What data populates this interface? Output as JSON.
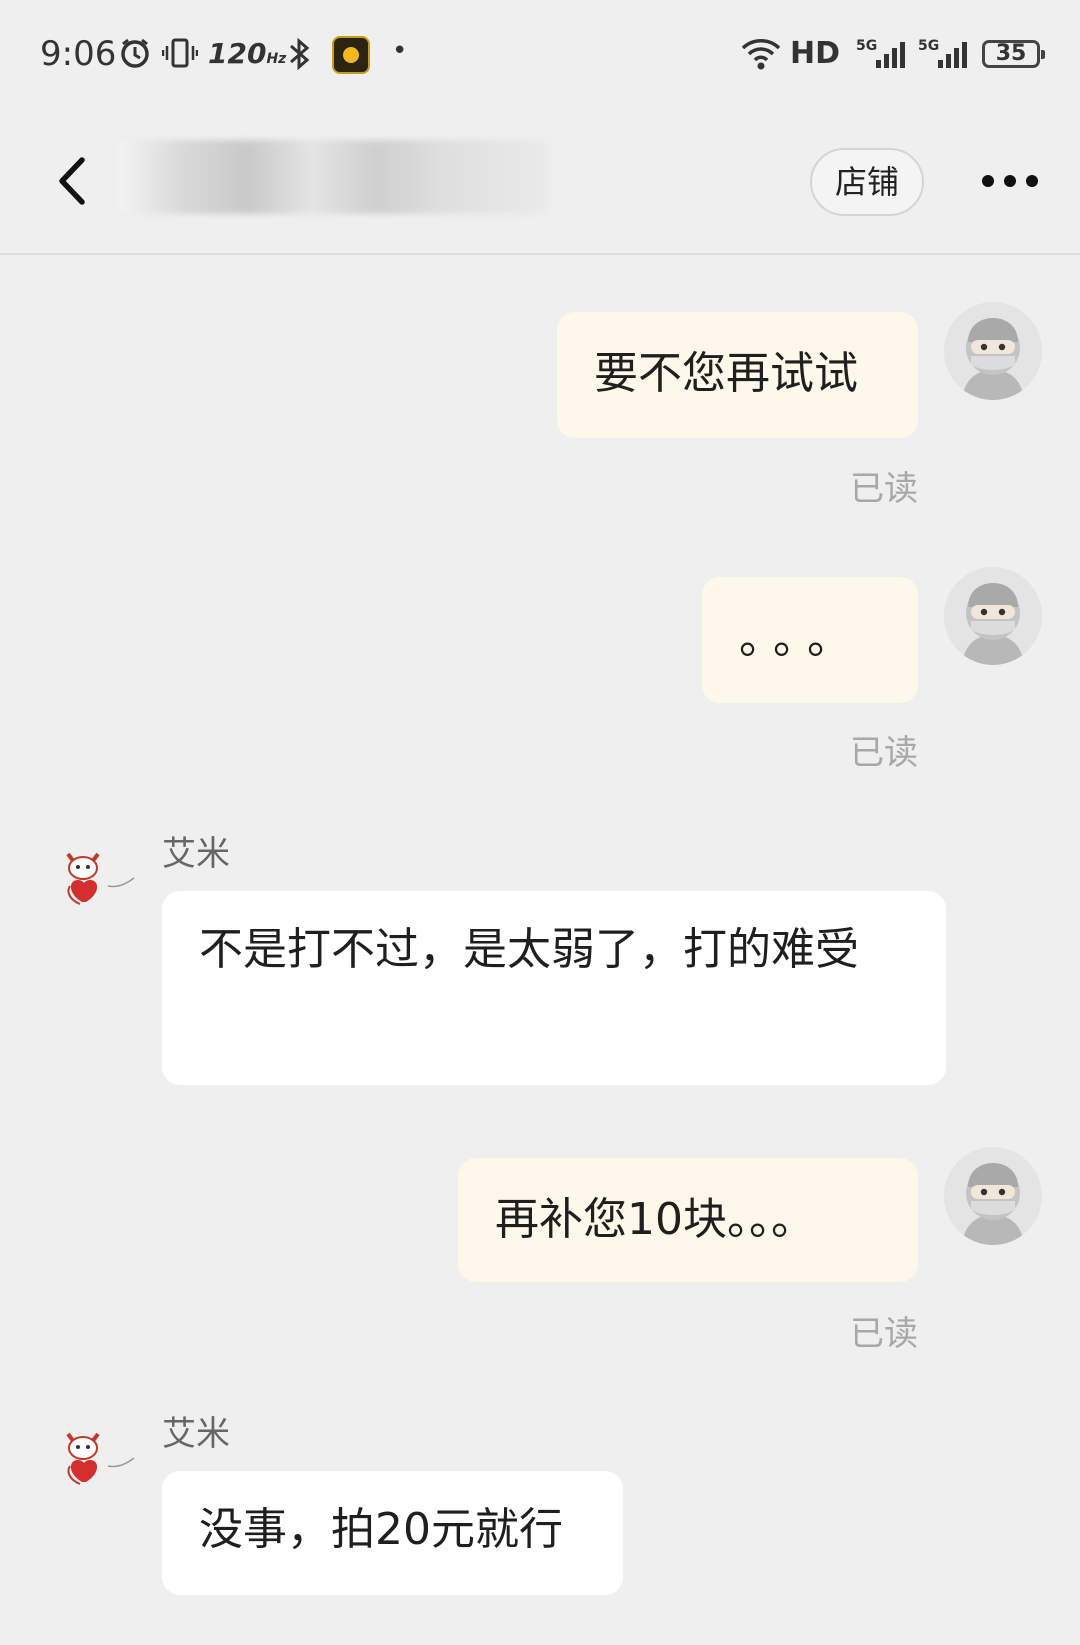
{
  "status_bar": {
    "time": "9:06",
    "refresh_rate": "120",
    "refresh_unit": "Hz",
    "network_label": "HD",
    "sim1": "5G",
    "sim2": "5G",
    "battery": "35",
    "icons": [
      "alarm-icon",
      "vibrate-icon",
      "bluetooth-icon",
      "app-notification-icon",
      "wifi-icon",
      "signal-icon",
      "battery-icon"
    ]
  },
  "header": {
    "shop_label": "店铺",
    "icons": [
      "back-arrow-icon",
      "more-dots-icon"
    ]
  },
  "messages": [
    {
      "from": "me",
      "text": "要不您再试试",
      "status": "已读"
    },
    {
      "from": "me",
      "text": "。。。",
      "status": "已读"
    },
    {
      "from": "them",
      "sender": "艾米",
      "text": "不是打不过，是太弱了，打的难受"
    },
    {
      "from": "me",
      "text": "再补您10块。。。",
      "status": "已读"
    },
    {
      "from": "them",
      "sender": "艾米",
      "text": "没事，拍20元就行"
    }
  ],
  "colors": {
    "background": "#efefef",
    "my_bubble": "#fdf8ea",
    "their_bubble": "#ffffff",
    "read_text": "#a8a8a8"
  }
}
